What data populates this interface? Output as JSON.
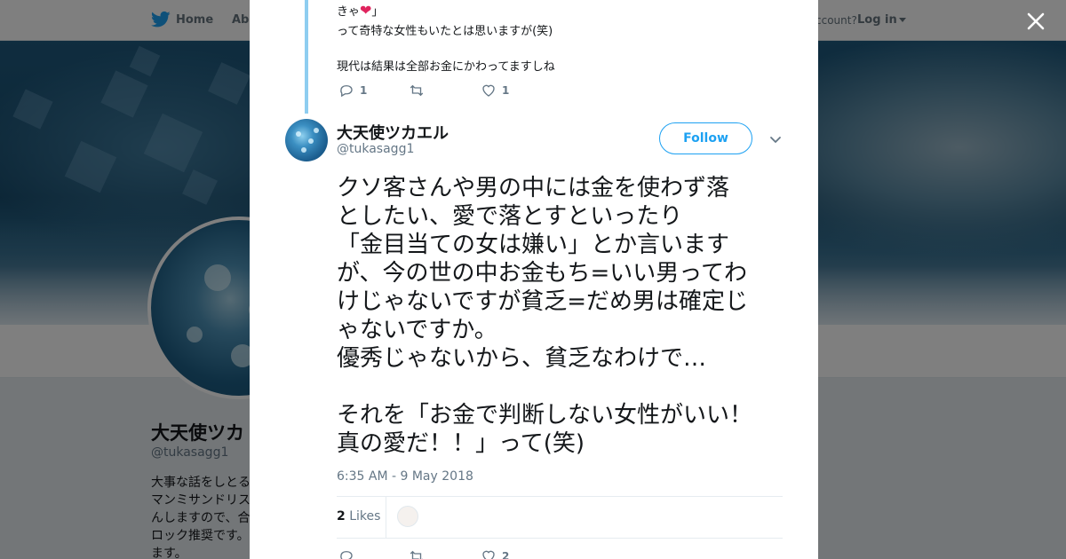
{
  "background_page": {
    "nav": {
      "home_label": "Home",
      "about_label": "Abo",
      "account_prompt": "ccount?",
      "login_label": "Log in"
    },
    "profile": {
      "name": "大天使ツカ",
      "handle": "@tukasagg1",
      "bio_lines": [
        "大事な話をしとる",
        "マンミサンドリス",
        "んしますので、合",
        "ロック推奨です。",
        "ます。"
      ]
    }
  },
  "modal": {
    "previous_tweet": {
      "line1_text": "きゃ",
      "line1_emoji": "❤️",
      "line1_close": "」",
      "line2": "って奇特な女性もいたとは思いますが(笑)",
      "line3": "現代は結果は全部お金にかわってますしね",
      "reply_count": "1",
      "retweet_count": "",
      "like_count": "1"
    },
    "tweet": {
      "author_name": "大天使ツカエル",
      "author_handle": "@tukasagg1",
      "follow_label": "Follow",
      "text_lines": [
        "クソ客さんや男の中には金を使わず落",
        "としたい、愛で落とすといったり",
        "「金目当ての女は嫌い」とか言います",
        "が、今の世の中お金もち=いい男ってわ",
        "けじゃないですが貧乏=だめ男は確定じ",
        "ゃないですか。",
        "優秀じゃないから、貧乏なわけで…",
        "",
        "それを「お金で判断しない女性がいい！",
        "真の愛だ！！」って(笑)"
      ],
      "timestamp": "6:35 AM - 9 May 2018",
      "likes_number": "2",
      "likes_label": "Likes",
      "bottom_reply_count": "",
      "bottom_retweet_count": "",
      "bottom_like_count": "2"
    }
  },
  "colors": {
    "twitter_blue": "#1da1f2",
    "text_primary": "#14171a",
    "text_secondary": "#657786",
    "heart_red": "#e0245e"
  },
  "icons": [
    "twitter-bird-icon",
    "close-icon",
    "reply-icon",
    "retweet-icon",
    "heart-icon",
    "chevron-down-icon"
  ]
}
